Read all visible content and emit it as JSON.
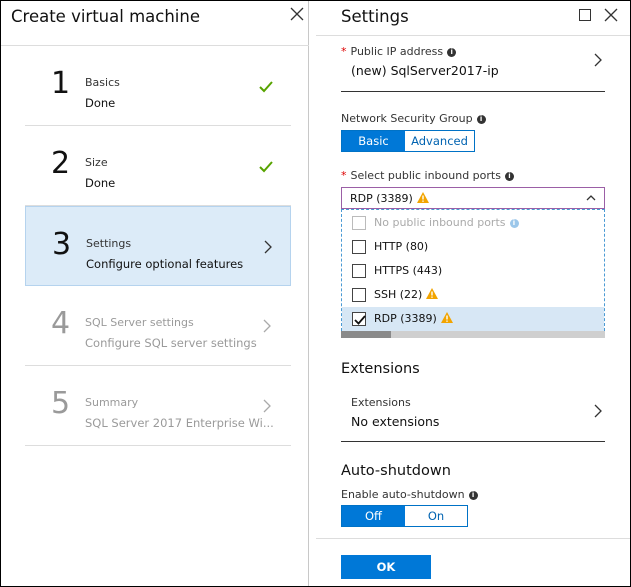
{
  "left_blade": {
    "title": "Create virtual machine",
    "steps": [
      {
        "num": "1",
        "label": "Basics",
        "sub": "Done"
      },
      {
        "num": "2",
        "label": "Size",
        "sub": "Done"
      },
      {
        "num": "3",
        "label": "Settings",
        "sub": "Configure optional features"
      },
      {
        "num": "4",
        "label": "SQL Server settings",
        "sub": "Configure SQL server settings"
      },
      {
        "num": "5",
        "label": "Summary",
        "sub": "SQL Server 2017 Enterprise Wi..."
      }
    ]
  },
  "right_blade": {
    "title": "Settings",
    "public_ip": {
      "label": "Public IP address",
      "value": "(new) SqlServer2017-ip"
    },
    "nsg": {
      "label": "Network Security Group",
      "options": [
        "Basic",
        "Advanced"
      ],
      "selected": "Basic"
    },
    "inbound": {
      "label": "Select public inbound ports",
      "selected_value": "RDP (3389)",
      "options": [
        {
          "label": "No public inbound ports",
          "checked": false,
          "disabled": true
        },
        {
          "label": "HTTP (80)",
          "checked": false
        },
        {
          "label": "HTTPS (443)",
          "checked": false
        },
        {
          "label": "SSH (22)",
          "checked": false,
          "warning": true
        },
        {
          "label": "RDP (3389)",
          "checked": true,
          "warning": true
        }
      ]
    },
    "extensions": {
      "heading": "Extensions",
      "label": "Extensions",
      "value": "No extensions"
    },
    "auto_shutdown": {
      "heading": "Auto-shutdown",
      "label": "Enable auto-shutdown",
      "options": [
        "Off",
        "On"
      ],
      "selected": "Off"
    },
    "ok_label": "OK"
  },
  "colors": {
    "accent": "#0078d7",
    "selected_step_bg": "#dcebf8",
    "check_green": "#57a300",
    "warning": "#f2a400"
  }
}
